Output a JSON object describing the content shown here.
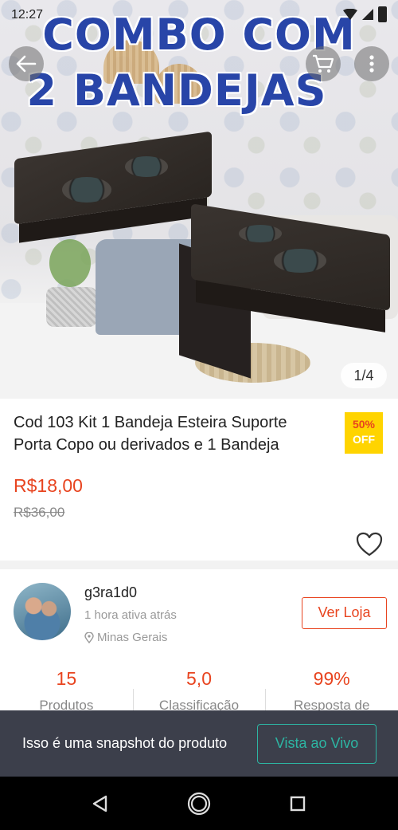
{
  "status_bar": {
    "time": "12:27",
    "battery": "100"
  },
  "hero": {
    "headline_line1": "COMBO COM",
    "headline_line2": "2 BANDEJAS",
    "image_counter": "1/4"
  },
  "product": {
    "title": "Cod 103 Kit 1 Bandeja Esteira Suporte Porta Copo ou derivados e 1 Bandeja",
    "discount_percent": "50%",
    "discount_label": "OFF",
    "price": "R$18,00",
    "original_price": "R$36,00"
  },
  "seller": {
    "name": "g3ra1d0",
    "active_status": "1 hora ativa atrás",
    "location": "Minas Gerais",
    "store_button": "Ver Loja",
    "stats": [
      {
        "value": "15",
        "label": "Produtos"
      },
      {
        "value": "5,0",
        "label": "Classificação"
      },
      {
        "value": "99%",
        "label": "Resposta de"
      }
    ]
  },
  "snapshot_bar": {
    "text": "Isso é uma snapshot do produto",
    "live_button": "Vista ao Vivo"
  },
  "icons": {
    "back": "arrow-left-icon",
    "cart": "cart-icon",
    "more": "more-vertical-icon",
    "favorite": "heart-icon",
    "location": "pin-icon"
  },
  "colors": {
    "accent": "#e8441f",
    "discount_bg": "#ffd400",
    "headline": "#2845a8",
    "snapshot_bg": "#3c3f4b",
    "live_accent": "#2db5a3"
  }
}
